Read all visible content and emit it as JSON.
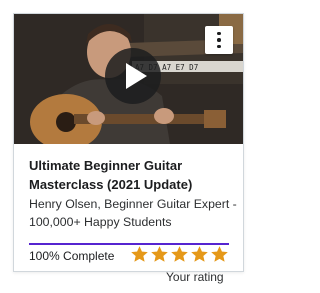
{
  "course": {
    "title": "Ultimate Beginner Guitar Masterclass (2021 Update)",
    "author": "Henry Olsen, Beginner Guitar Expert - 100,000+ Happy Students"
  },
  "thumbnail": {
    "chord_chart": "A7 D7 A7 E7 D7",
    "play_icon": "play-icon",
    "menu_icon": "more-vertical-icon"
  },
  "progress": {
    "label": "100% Complete",
    "value": 1.0,
    "color": "#5624d0"
  },
  "rating": {
    "stars": 5,
    "max": 5,
    "label": "Your rating",
    "color": "#e59819"
  }
}
